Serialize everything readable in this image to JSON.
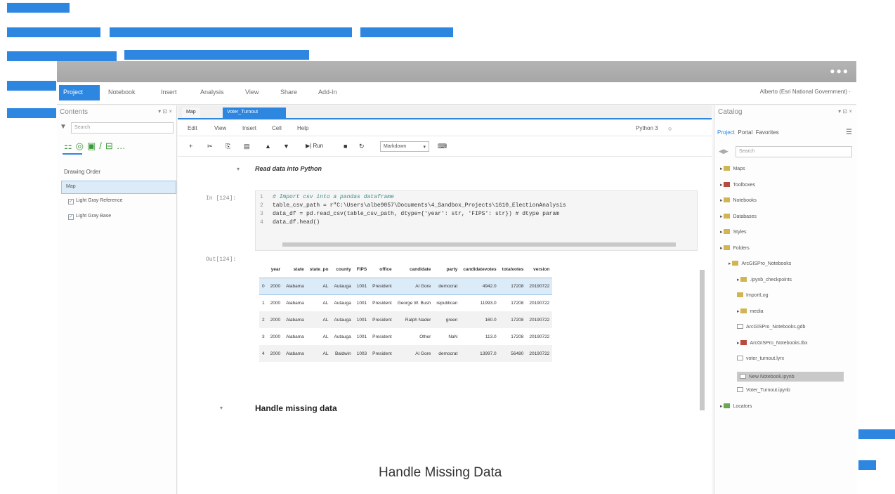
{
  "ribbon": {
    "tabs": [
      "Project",
      "Notebook",
      "Insert",
      "Analysis",
      "View",
      "Share",
      "Add-In"
    ],
    "user": "Alberto (Esri National Government) ·"
  },
  "contents": {
    "title": "Contents",
    "controls": "▾ ⊡ ×",
    "search_placeholder": "Search",
    "drawing_order": "Drawing Order",
    "layers": [
      "Map",
      "Light Gray Reference",
      "Light Gray Base"
    ]
  },
  "doc_tabs": [
    "Map",
    "Voter_Turnout"
  ],
  "menu": [
    "Edit",
    "View",
    "Insert",
    "Cell",
    "Help"
  ],
  "kernel": "Python 3",
  "toolbar": {
    "run_label": "Run",
    "cell_type": "Markdown"
  },
  "notebook": {
    "heading1": "Read data into Python",
    "in_prompt": "In [124]:",
    "out_prompt": "Out[124]:",
    "code": [
      {
        "num": "1",
        "text": "# Import csv into a pandas dataframe"
      },
      {
        "num": "2",
        "text": "table_csv_path = r\"C:\\Users\\albe9057\\Documents\\4_Sandbox_Projects\\1610_ElectionAnalysis"
      },
      {
        "num": "3",
        "text": "data_df = pd.read_csv(table_csv_path, dtype={'year': str, 'FIPS': str})  # dtype param"
      },
      {
        "num": "4",
        "text": "data_df.head()"
      }
    ],
    "table": {
      "columns": [
        "",
        "year",
        "state",
        "state_po",
        "county",
        "FIPS",
        "office",
        "candidate",
        "party",
        "candidatevotes",
        "totalvotes",
        "version"
      ],
      "rows": [
        [
          "0",
          "2000",
          "Alabama",
          "AL",
          "Autauga",
          "1001",
          "President",
          "Al Gore",
          "democrat",
          "4942.0",
          "17208",
          "20190722"
        ],
        [
          "1",
          "2000",
          "Alabama",
          "AL",
          "Autauga",
          "1001",
          "President",
          "George W. Bush",
          "republican",
          "11993.0",
          "17208",
          "20190722"
        ],
        [
          "2",
          "2000",
          "Alabama",
          "AL",
          "Autauga",
          "1001",
          "President",
          "Ralph Nader",
          "green",
          "160.0",
          "17208",
          "20190722"
        ],
        [
          "3",
          "2000",
          "Alabama",
          "AL",
          "Autauga",
          "1001",
          "President",
          "Other",
          "NaN",
          "113.0",
          "17208",
          "20190722"
        ],
        [
          "4",
          "2000",
          "Alabama",
          "AL",
          "Baldwin",
          "1003",
          "President",
          "Al Gore",
          "democrat",
          "13997.0",
          "56480",
          "20190722"
        ]
      ]
    },
    "heading2": "Handle missing data",
    "caption": "Handle Missing Data"
  },
  "catalog": {
    "title": "Catalog",
    "controls": "▾ ⊡ ×",
    "tabs": [
      "Project",
      "Portal",
      "Favorites"
    ],
    "search_placeholder": "Search",
    "items": [
      "Maps",
      "Toolboxes",
      "Notebooks",
      "Databases",
      "Styles",
      "Folders",
      "ArcGISPro_Notebooks",
      ".ipynb_checkpoints",
      "ImportLog",
      "media",
      "ArcGISPro_Notebooks.gdb",
      "ArcGISPro_Notebooks.tbx",
      "voter_turnout.lyrx",
      "New Notebook.ipynb",
      "Voter_Turnout.ipynb",
      "Locators"
    ]
  },
  "colors": {
    "accent": "#2d86e0",
    "titlebar": "#a8a8a8"
  }
}
